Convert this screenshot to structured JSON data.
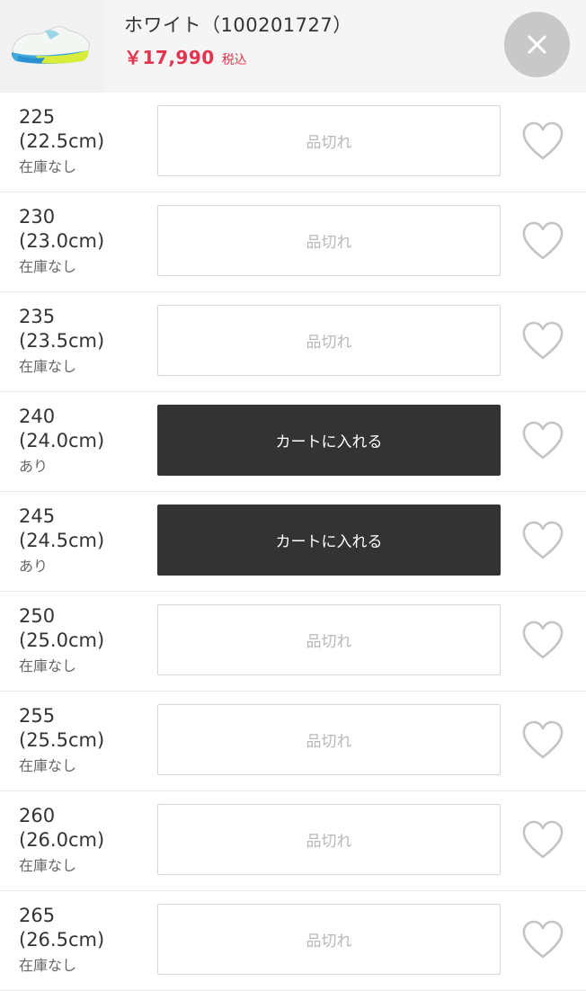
{
  "header": {
    "title": "ホワイト（100201727）",
    "price": "￥17,990",
    "tax_label": "税込",
    "close_icon": "close-icon",
    "thumbnail": "shoe-thumbnail"
  },
  "colors": {
    "price": "#e6334d",
    "cart_button": "#333333",
    "soldout_border": "#d6d6d6"
  },
  "sizes": [
    {
      "size": "225",
      "cm": "(22.5cm)",
      "stock": "在庫なし",
      "action": "品切れ",
      "available": false
    },
    {
      "size": "230",
      "cm": "(23.0cm)",
      "stock": "在庫なし",
      "action": "品切れ",
      "available": false
    },
    {
      "size": "235",
      "cm": "(23.5cm)",
      "stock": "在庫なし",
      "action": "品切れ",
      "available": false
    },
    {
      "size": "240",
      "cm": "(24.0cm)",
      "stock": "あり",
      "action": "カートに入れる",
      "available": true
    },
    {
      "size": "245",
      "cm": "(24.5cm)",
      "stock": "あり",
      "action": "カートに入れる",
      "available": true
    },
    {
      "size": "250",
      "cm": "(25.0cm)",
      "stock": "在庫なし",
      "action": "品切れ",
      "available": false
    },
    {
      "size": "255",
      "cm": "(25.5cm)",
      "stock": "在庫なし",
      "action": "品切れ",
      "available": false
    },
    {
      "size": "260",
      "cm": "(26.0cm)",
      "stock": "在庫なし",
      "action": "品切れ",
      "available": false
    },
    {
      "size": "265",
      "cm": "(26.5cm)",
      "stock": "在庫なし",
      "action": "品切れ",
      "available": false
    }
  ]
}
